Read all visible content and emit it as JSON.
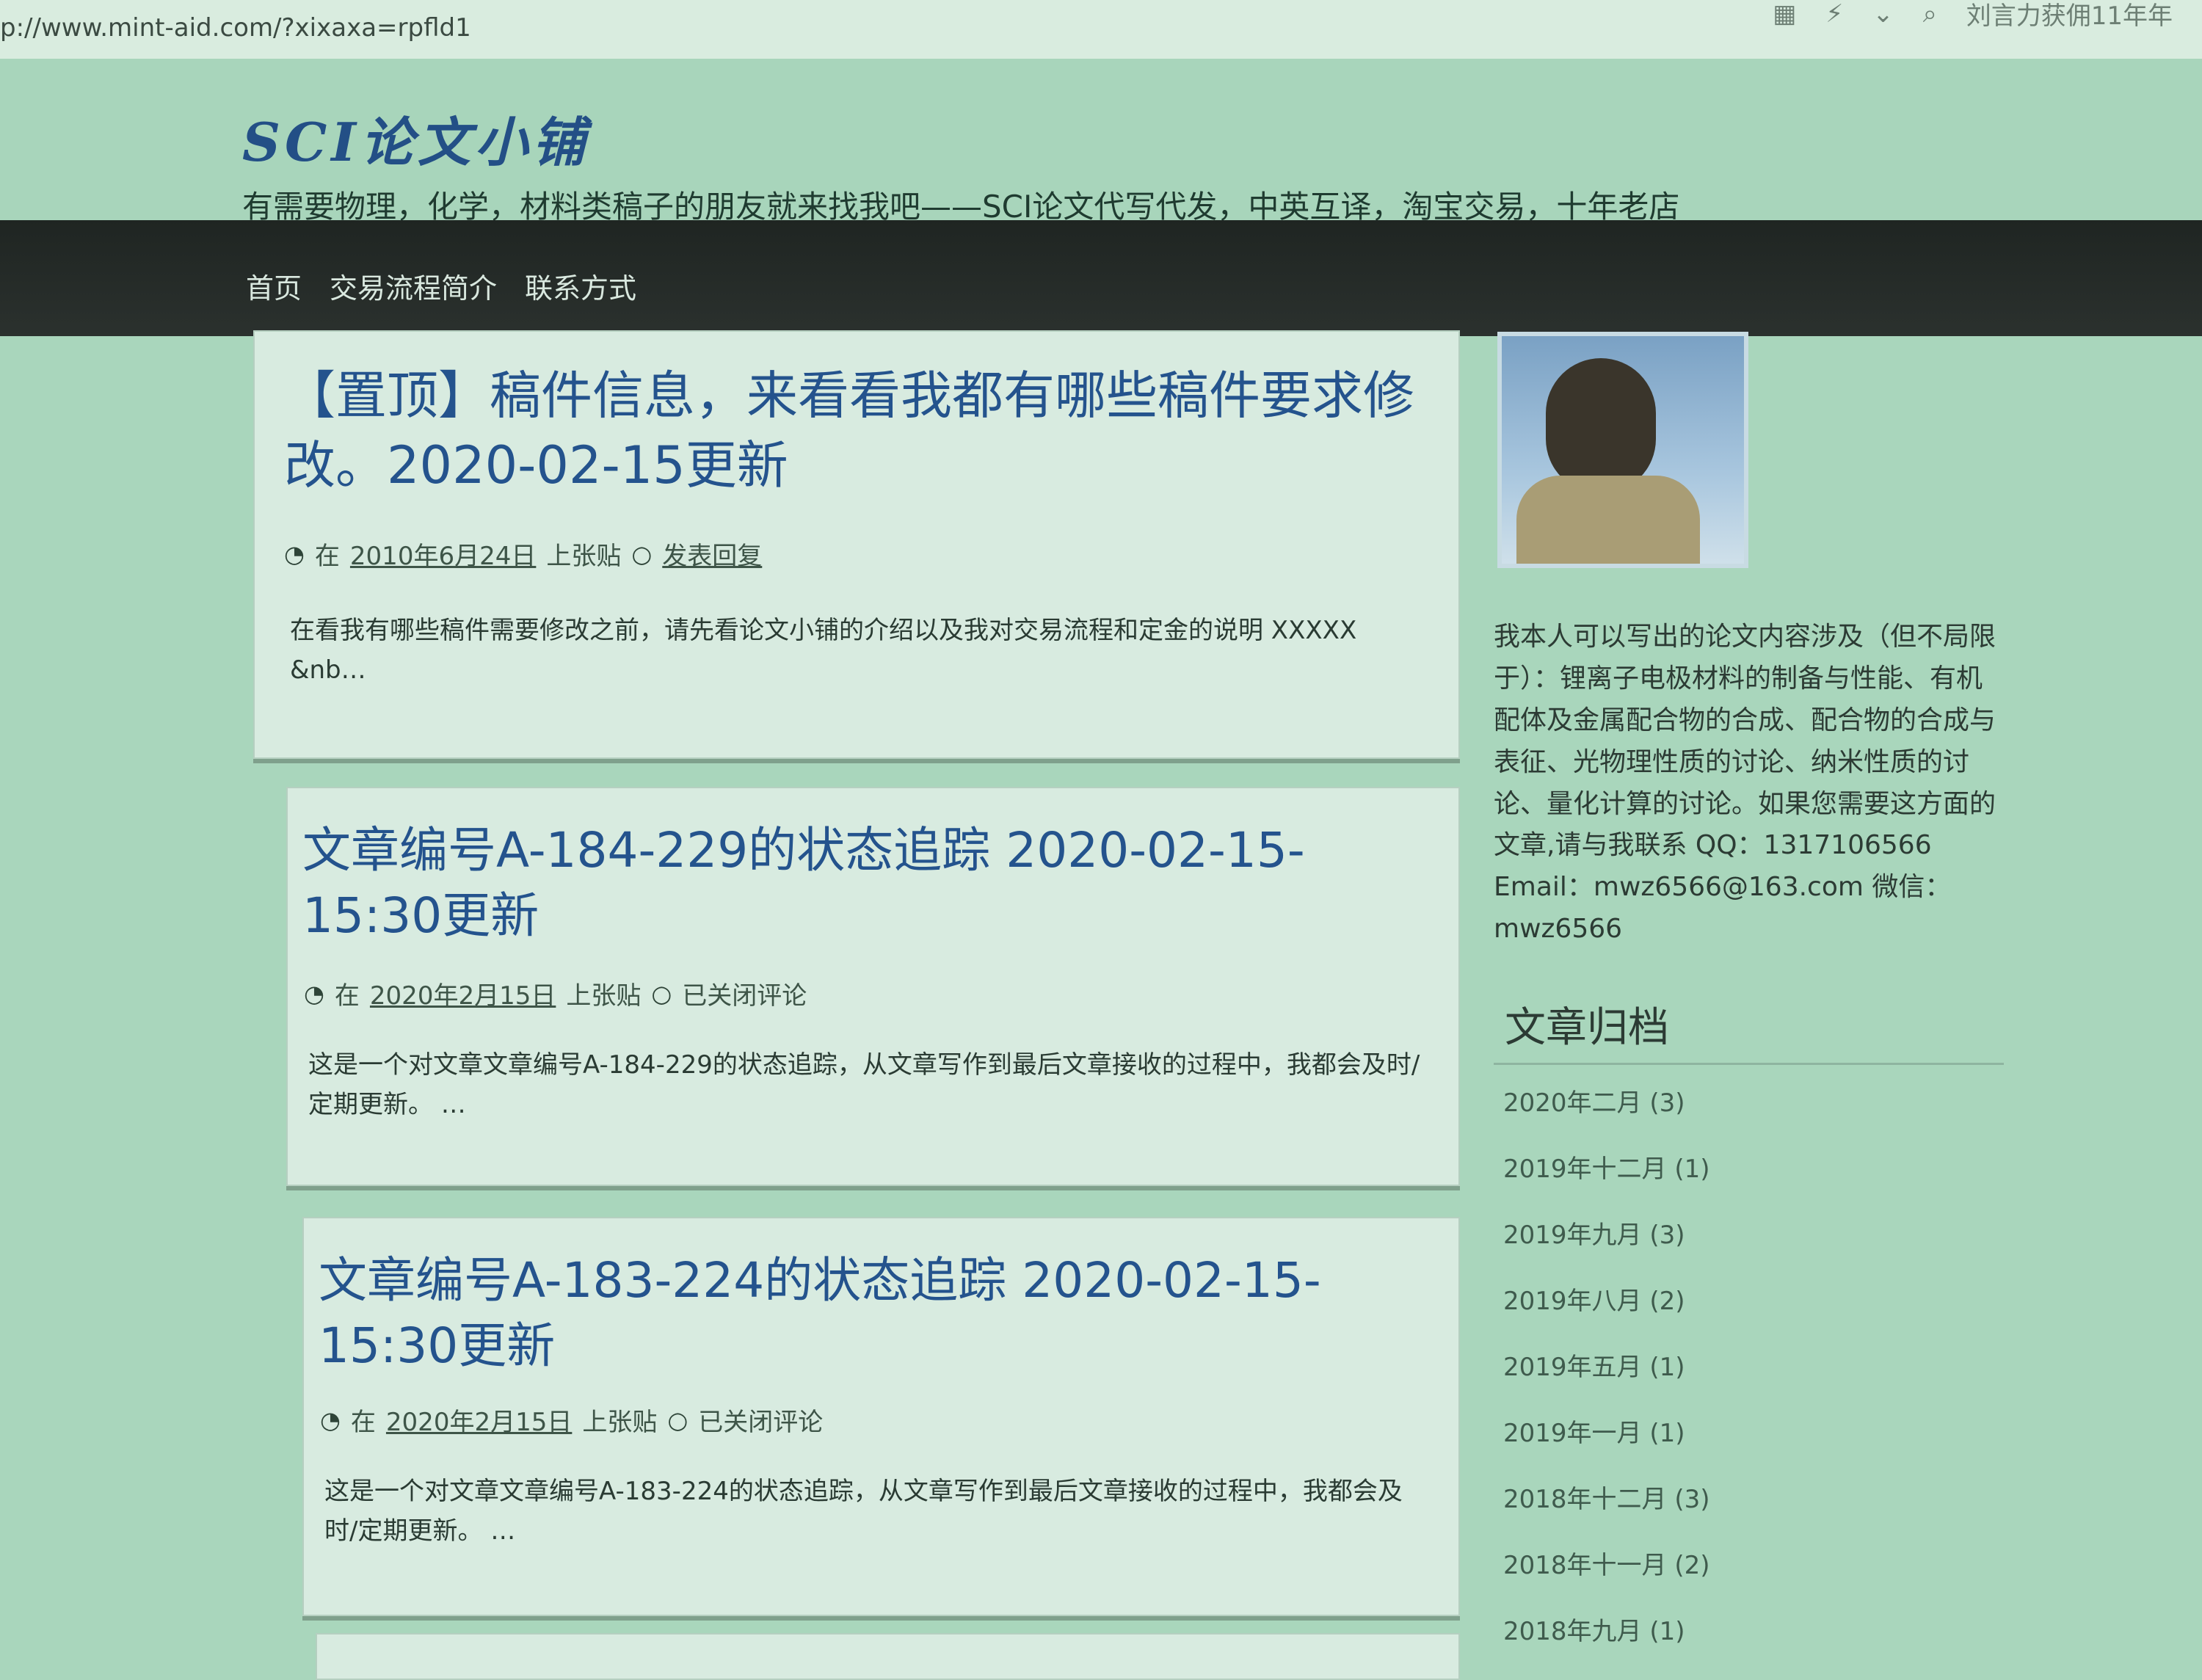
{
  "browser": {
    "url": "p://www.mint-aid.com/?xixaxa=rpfld1",
    "search_text": "刘言力获佣11年年"
  },
  "site": {
    "title": "SCI论文小铺",
    "tagline": "有需要物理，化学，材料类稿子的朋友就来找我吧——SCI论文代写代发，中英互译，淘宝交易，十年老店"
  },
  "nav": {
    "items": [
      "首页",
      "交易流程简介",
      "联系方式"
    ]
  },
  "posts": [
    {
      "title": "【置顶】稿件信息，来看看我都有哪些稿件要求修改。2020-02-15更新",
      "meta_prefix": "在",
      "date": "2010年6月24日",
      "author": "上张贴",
      "comments": "发表回复",
      "excerpt": "在看我有哪些稿件需要修改之前，请先看论文小铺的介绍以及我对交易流程和定金的说明 XXXXX &nb…"
    },
    {
      "title": "文章编号A-184-229的状态追踪 2020-02-15-15:30更新",
      "meta_prefix": "在",
      "date": "2020年2月15日",
      "author": "上张贴",
      "comments": "已关闭评论",
      "excerpt": "这是一个对文章文章编号A-184-229的状态追踪，从文章写作到最后文章接收的过程中，我都会及时/定期更新。 …"
    },
    {
      "title": "文章编号A-183-224的状态追踪 2020-02-15-15:30更新",
      "meta_prefix": "在",
      "date": "2020年2月15日",
      "author": "上张贴",
      "comments": "已关闭评论",
      "excerpt": "这是一个对文章文章编号A-183-224的状态追踪，从文章写作到最后文章接收的过程中，我都会及时/定期更新。 …"
    }
  ],
  "sidebar": {
    "about": "我本人可以写出的论文内容涉及（但不局限于）：锂离子电极材料的制备与性能、有机配体及金属配合物的合成、配合物的合成与表征、光物理性质的讨论、纳米性质的讨论、量化计算的讨论。如果您需要这方面的文章,请与我联系 QQ：1317106566 Email：mwz6566@163.com 微信：mwz6566",
    "archive_title": "文章归档",
    "archives": [
      "2020年二月 (3)",
      "2019年十二月 (1)",
      "2019年九月 (3)",
      "2019年八月 (2)",
      "2019年五月 (1)",
      "2019年一月 (1)",
      "2018年十二月 (3)",
      "2018年十一月 (2)",
      "2018年九月 (1)"
    ]
  },
  "colors": {
    "background": "#a9d6bc",
    "nav": "#1f2522",
    "title_blue": "#24538d"
  }
}
